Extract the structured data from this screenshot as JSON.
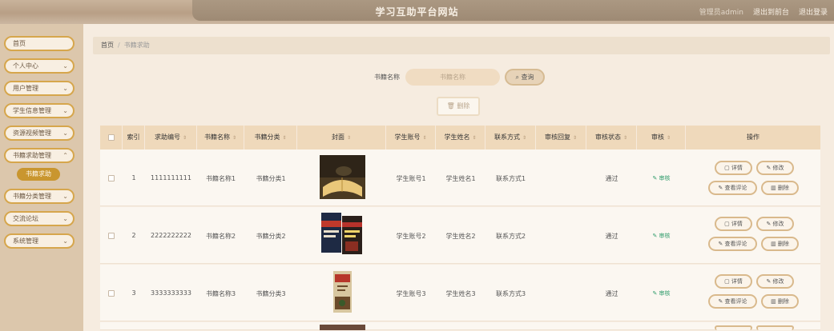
{
  "header": {
    "title": "学习互助平台网站",
    "links": [
      "管理员admin",
      "退出到前台",
      "退出登录"
    ]
  },
  "sidebar": {
    "items": [
      {
        "label": "首页",
        "chevron": false
      },
      {
        "label": "个人中心",
        "chevron": true
      },
      {
        "label": "用户管理",
        "chevron": true
      },
      {
        "label": "学生信息管理",
        "chevron": true
      },
      {
        "label": "资源视频管理",
        "chevron": true
      },
      {
        "label": "书籍求助管理",
        "chevron": true
      },
      {
        "label": "书籍分类管理",
        "chevron": true
      },
      {
        "label": "交流论坛",
        "chevron": true
      },
      {
        "label": "系统管理",
        "chevron": true
      }
    ],
    "active_sub": "书籍求助"
  },
  "breadcrumb": {
    "home": "首页",
    "current": "书籍求助"
  },
  "search": {
    "label": "书籍名称",
    "placeholder": "书籍名称",
    "button": "查询",
    "search_icon": "search-icon"
  },
  "toolbar": {
    "delete_label": "删除"
  },
  "table": {
    "columns": [
      "",
      "索引",
      "求助编号",
      "书籍名称",
      "书籍分类",
      "封面",
      "学生账号",
      "学生姓名",
      "联系方式",
      "审核回复",
      "审核状态",
      "审核",
      "操作"
    ],
    "rows": [
      {
        "index": "1",
        "code": "1111111111",
        "name": "书籍名称1",
        "category": "书籍分类1",
        "account": "学生账号1",
        "student": "学生姓名1",
        "contact": "联系方式1",
        "reply": "",
        "status": "通过",
        "audit": "审核"
      },
      {
        "index": "2",
        "code": "2222222222",
        "name": "书籍名称2",
        "category": "书籍分类2",
        "account": "学生账号2",
        "student": "学生姓名2",
        "contact": "联系方式2",
        "reply": "",
        "status": "通过",
        "audit": "审核"
      },
      {
        "index": "3",
        "code": "3333333333",
        "name": "书籍名称3",
        "category": "书籍分类3",
        "account": "学生账号3",
        "student": "学生姓名3",
        "contact": "联系方式3",
        "reply": "",
        "status": "通过",
        "audit": "审核"
      }
    ],
    "actions": {
      "detail": "详情",
      "edit": "修改",
      "comments": "查看评论",
      "delete": "删除"
    }
  },
  "colors": {
    "accent": "#d6a64c",
    "header": "#b89f86",
    "table_head": "#efd9bb",
    "approve": "#2e9b6a"
  }
}
